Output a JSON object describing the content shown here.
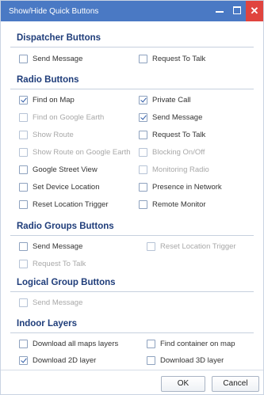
{
  "window": {
    "title": "Show/Hide Quick Buttons",
    "minimize_icon": "minimize-icon",
    "maximize_icon": "maximize-icon",
    "close_icon": "close-icon",
    "close_glyph": "✕"
  },
  "colors": {
    "titlebar": "#4a79c4",
    "close_button": "#e0443e",
    "section_header": "#1f3d7a",
    "checkmark": "#2d5aa7"
  },
  "sections": {
    "dispatcher": {
      "title": "Dispatcher Buttons",
      "options": [
        {
          "label": "Send Message",
          "checked": false,
          "disabled": false
        },
        {
          "label": "Request To Talk",
          "checked": false,
          "disabled": false
        }
      ]
    },
    "radio": {
      "title": "Radio Buttons",
      "options": [
        {
          "label": "Find on Map",
          "checked": true,
          "disabled": false
        },
        {
          "label": "Private Call",
          "checked": true,
          "disabled": false
        },
        {
          "label": "Find on Google Earth",
          "checked": false,
          "disabled": true
        },
        {
          "label": "Send Message",
          "checked": true,
          "disabled": false
        },
        {
          "label": "Show Route",
          "checked": false,
          "disabled": true
        },
        {
          "label": "Request To Talk",
          "checked": false,
          "disabled": false
        },
        {
          "label": "Show Route on Google Earth",
          "checked": false,
          "disabled": true
        },
        {
          "label": "Blocking On/Off",
          "checked": false,
          "disabled": true
        },
        {
          "label": "Google Street View",
          "checked": false,
          "disabled": false
        },
        {
          "label": "Monitoring Radio",
          "checked": false,
          "disabled": true
        },
        {
          "label": "Set Device Location",
          "checked": false,
          "disabled": false
        },
        {
          "label": "Presence in Network",
          "checked": false,
          "disabled": false
        },
        {
          "label": "Reset Location Trigger",
          "checked": false,
          "disabled": false
        },
        {
          "label": "Remote Monitor",
          "checked": false,
          "disabled": false
        }
      ]
    },
    "radio_groups": {
      "title": "Radio Groups Buttons",
      "options": [
        {
          "label": "Send Message",
          "checked": false,
          "disabled": false
        },
        {
          "label": "Reset Location Trigger",
          "checked": false,
          "disabled": true
        },
        {
          "label": "Request To Talk",
          "checked": false,
          "disabled": true
        }
      ]
    },
    "logical_group": {
      "title": "Logical Group Buttons",
      "options": [
        {
          "label": "Send Message",
          "checked": false,
          "disabled": true
        }
      ]
    },
    "indoor": {
      "title": "Indoor Layers",
      "options": [
        {
          "label": "Download all maps layers",
          "checked": false,
          "disabled": false
        },
        {
          "label": "Find container on map",
          "checked": false,
          "disabled": false
        },
        {
          "label": "Download 2D layer",
          "checked": true,
          "disabled": false
        },
        {
          "label": "Download 3D layer",
          "checked": false,
          "disabled": false
        }
      ]
    }
  },
  "footer": {
    "ok_label": "OK",
    "cancel_label": "Cancel"
  }
}
